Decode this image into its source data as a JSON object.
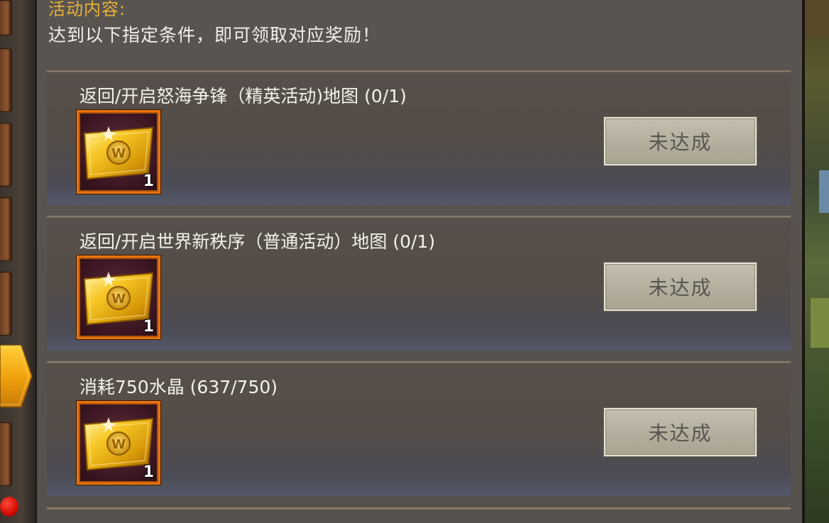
{
  "header": {
    "section_label": "活动内容:",
    "description": "达到以下指定条件，即可领取对应奖励！"
  },
  "tasks": [
    {
      "title": "返回/开启怒海争锋（精英活动)地图 (0/1)",
      "reward_icon": "gold-ticket-icon",
      "reward_count": "1",
      "status": "未达成"
    },
    {
      "title": "返回/开启世界新秩序（普通活动）地图 (0/1)",
      "reward_icon": "gold-ticket-icon",
      "reward_count": "1",
      "status": "未达成"
    },
    {
      "title": "消耗750水晶 (637/750)",
      "reward_icon": "gold-ticket-icon",
      "reward_count": "1",
      "status": "未达成"
    }
  ],
  "colors": {
    "header_label": "#e7b23a",
    "reward_border": "#e7720e",
    "panel_bg": "#595450"
  }
}
